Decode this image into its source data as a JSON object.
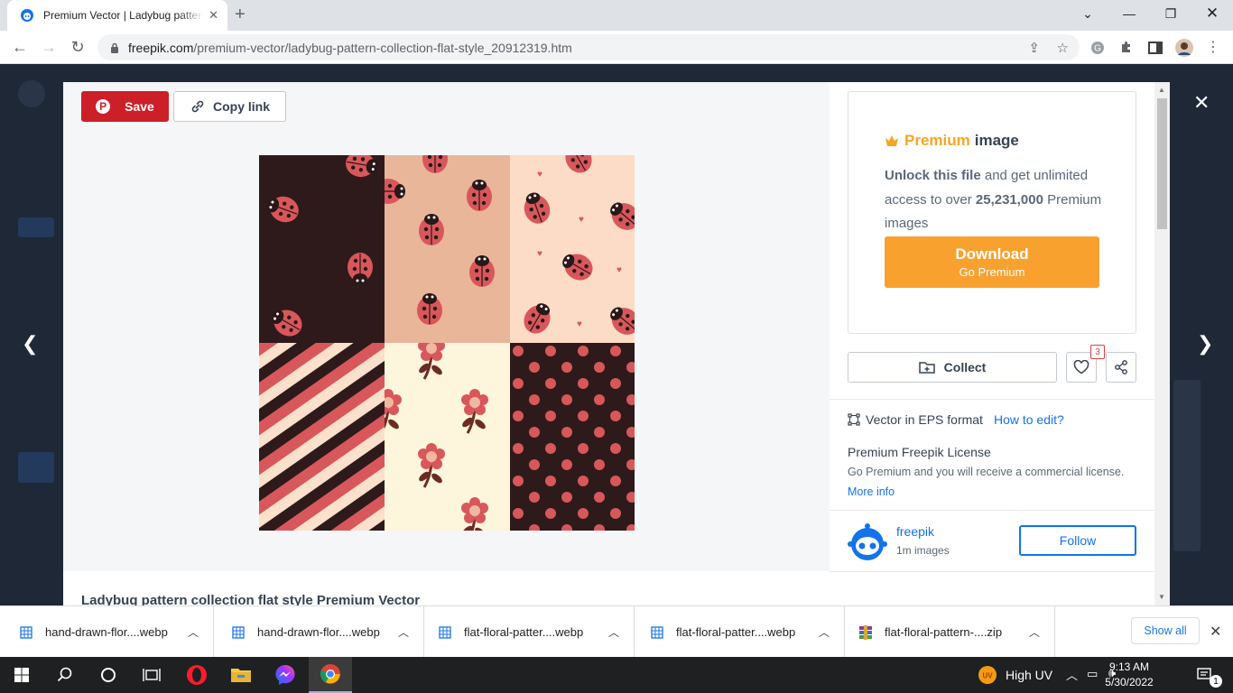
{
  "browser": {
    "tab_title": "Premium Vector | Ladybug pattern collection flat style",
    "url_host": "freepik.com",
    "url_path": "/premium-vector/ladybug-pattern-collection-flat-style_20912319.htm"
  },
  "modal": {
    "save_label": "Save",
    "copy_link_label": "Copy link",
    "title": "Ladybug pattern collection flat style Premium Vector"
  },
  "premium": {
    "word": "Premium",
    "image_word": "image",
    "unlock_bold": "Unlock this file",
    "unlock_rest": "and get unlimited access to over",
    "count": "25,231,000",
    "tail": "Premium images",
    "download_label": "Download",
    "download_sub": "Go Premium"
  },
  "actions": {
    "collect_label": "Collect",
    "like_count": "3"
  },
  "info": {
    "format_text": "Vector in EPS format",
    "how_to_edit": "How to edit?",
    "license_title": "Premium Freepik License",
    "license_text": "Go Premium and you will receive a commercial license.",
    "more_info": "More info"
  },
  "author": {
    "name": "freepik",
    "count": "1m images",
    "follow_label": "Follow"
  },
  "downloads": {
    "items": [
      {
        "name": "hand-drawn-flor....webp"
      },
      {
        "name": "hand-drawn-flor....webp"
      },
      {
        "name": "flat-floral-patter....webp"
      },
      {
        "name": "flat-floral-patter....webp"
      },
      {
        "name": "flat-floral-pattern-....zip"
      }
    ],
    "show_all": "Show all"
  },
  "taskbar": {
    "weather": "High UV",
    "time": "9:13 AM",
    "date": "5/30/2022",
    "notifications": "1"
  },
  "colors": {
    "save_red": "#cc1f28",
    "download_orange": "#f9a12e",
    "premium_gold": "#f5a623",
    "link_blue": "#1273eb"
  }
}
